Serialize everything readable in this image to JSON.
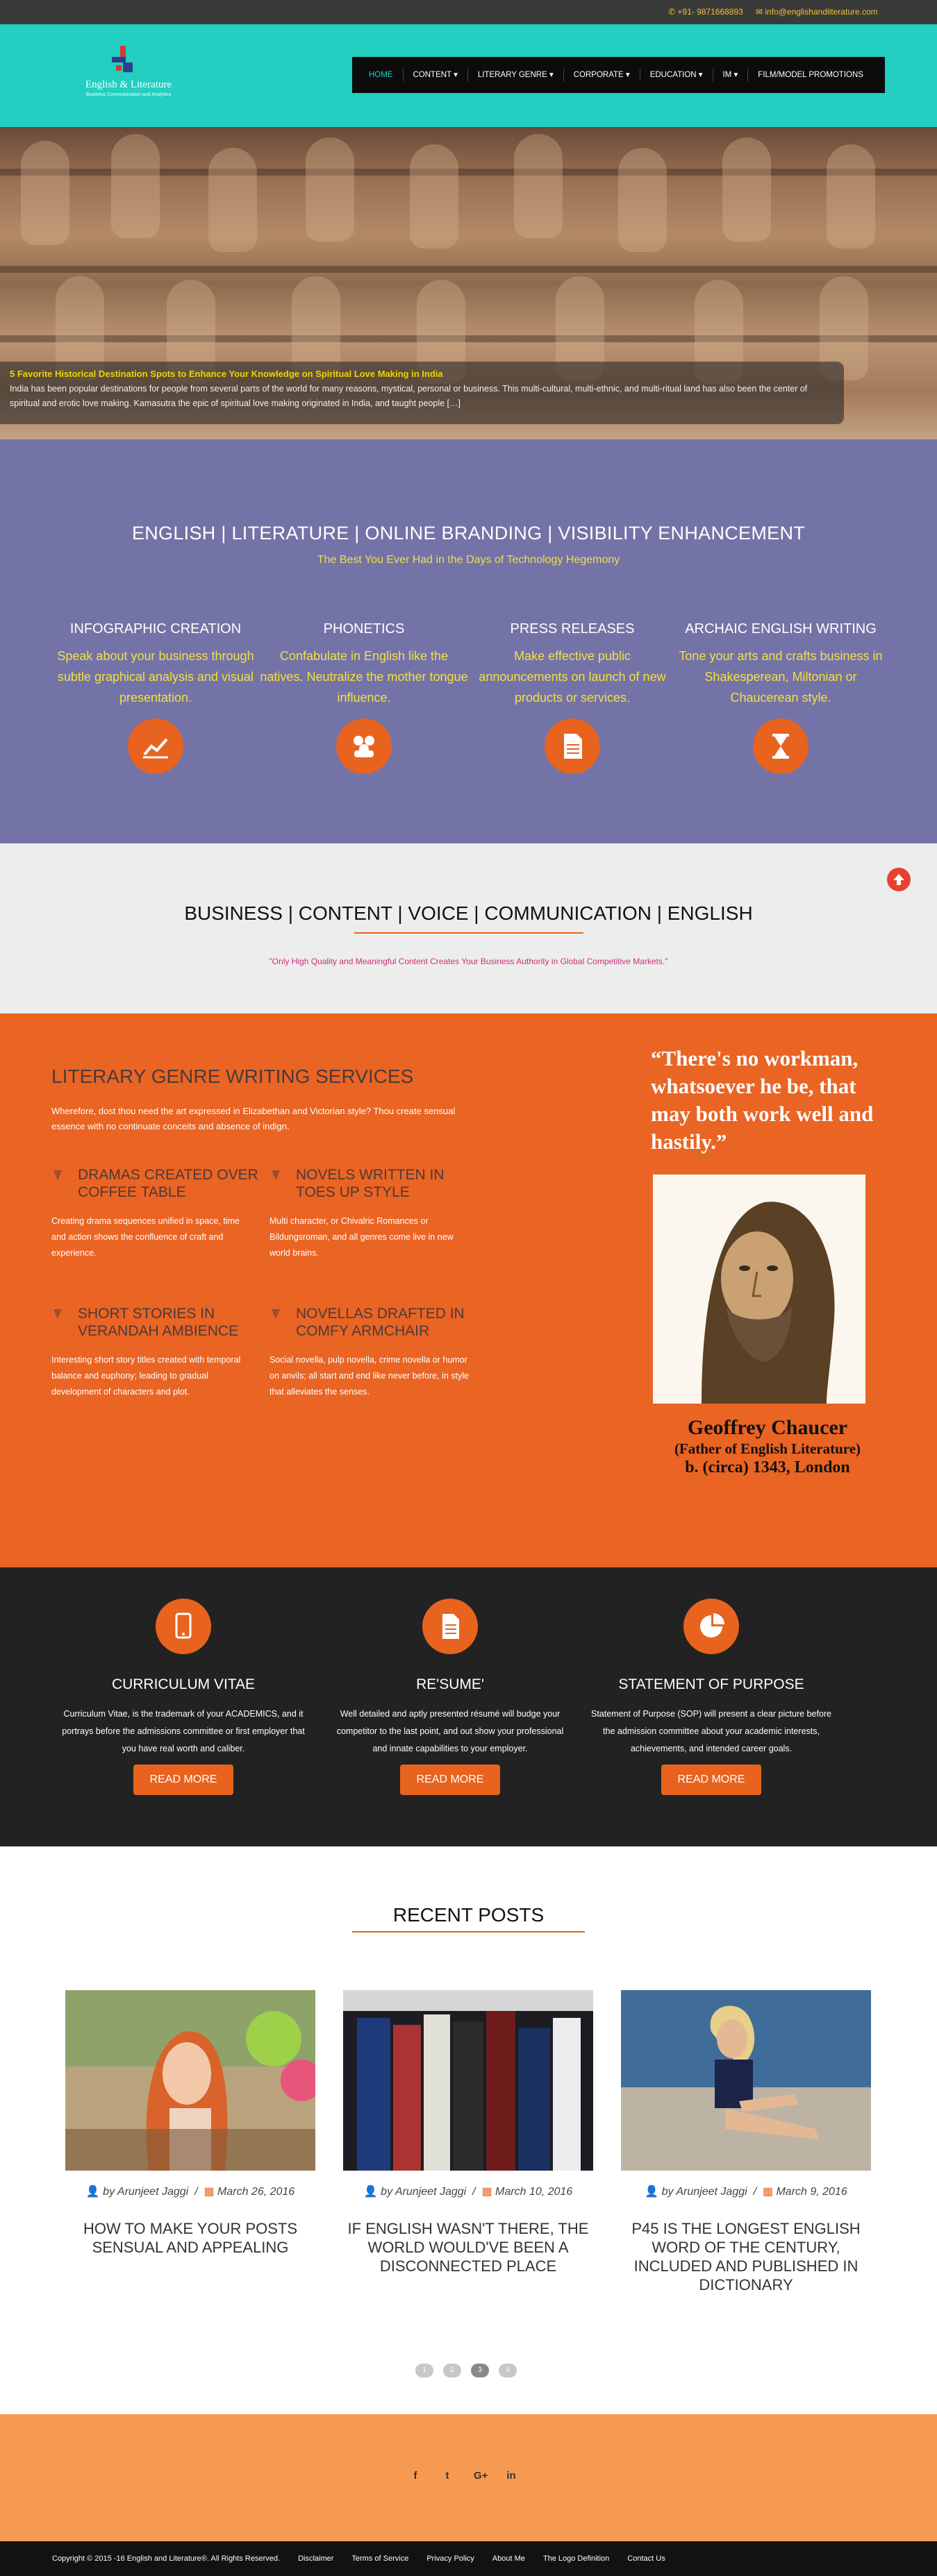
{
  "topbar": {
    "phone": "+91- 9871668893",
    "email": "info@englishandliterature.com"
  },
  "logo": {
    "name": "English & Literature",
    "tagline": "Business Communication and Analytics"
  },
  "nav": {
    "items": [
      "HOME",
      "CONTENT ▾",
      "LITERARY GENRE ▾",
      "CORPORATE ▾",
      "EDUCATION ▾",
      "IM ▾",
      "FILM/MODEL PROMOTIONS"
    ]
  },
  "hero": {
    "title": "5 Favorite Historical Destination Spots to Enhance Your Knowledge on Spiritual Love Making in India",
    "text": "India has been popular destinations for people from several parts of the world for many reasons, mystical, personal or business.  This multi-cultural, multi-ethnic, and multi-ritual land has also been the center of spiritual and erotic love making. Kamasutra the epic of spiritual love making originated in India, and taught people […]"
  },
  "services": {
    "heading": "ENGLISH | LITERATURE | ONLINE BRANDING | VISIBILITY ENHANCEMENT",
    "subheading": "The Best You Ever Had in the Days of Technology Hegemony",
    "items": [
      {
        "title": "INFOGRAPHIC CREATION",
        "desc": "Speak about your business through subtle graphical analysis and visual presentation.",
        "icon": "chart-line-icon"
      },
      {
        "title": "PHONETICS",
        "desc": "Confabulate in English like the natives. Neutralize the mother tongue influence.",
        "icon": "users-icon"
      },
      {
        "title": "PRESS RELEASES",
        "desc": "Make effective public announcements on launch of new products or services.",
        "icon": "document-icon"
      },
      {
        "title": "ARCHAIC ENGLISH WRITING",
        "desc": "Tone your arts and crafts business in Shakesperean, Miltonian or Chaucerean style.",
        "icon": "hourglass-icon"
      }
    ]
  },
  "business": {
    "heading": "BUSINESS | CONTENT | VOICE | COMMUNICATION | ENGLISH",
    "quote": "\"Only High Quality and Meaningful Content Creates Your Business Authority in Global Competitive Markets.\""
  },
  "literary": {
    "heading": "LITERARY GENRE WRITING SERVICES",
    "intro": "Wherefore, dost thou need the art expressed in Elizabethan and Victorian style? Thou create sensual essence with no continuate conceits and absence of indign.",
    "boxes": [
      {
        "title": "DRAMAS CREATED OVER COFFEE TABLE",
        "desc": "Creating drama sequences unified in space, time and action shows the confluence of craft and experience."
      },
      {
        "title": "NOVELS WRITTEN IN TOES UP STYLE",
        "desc": "Multi character, or Chivalric Romances or Bildungsroman, and all genres come live in new world brains."
      },
      {
        "title": "SHORT STORIES IN VERANDAH AMBIENCE",
        "desc": "Interesting short story titles created with temporal balance and euphony; leading to gradual development of characters and plot."
      },
      {
        "title": "NOVELLAS DRAFTED IN COMFY ARMCHAIR",
        "desc": "Social novella, pulp novella, crime novella or humor on anvils; all start and end like never before, in style that alleviates the senses."
      }
    ],
    "quote": "“There's no workman, whatsoever he be, that may both work well and hastily.”",
    "person_name": "Geoffrey Chaucer",
    "person_role": "(Father of English Literature)",
    "person_born": "b. (circa) 1343, London"
  },
  "docs": {
    "items": [
      {
        "title": "CURRICULUM VITAE",
        "desc": "Curriculum Vitae, is the trademark of your ACADEMICS, and it portrays before the admissions committee or first employer that you have real worth and caliber.",
        "button": "READ MORE",
        "icon": "tablet-icon"
      },
      {
        "title": "RE'SUME'",
        "desc": "Well detailed and aptly presented résumé will budge your competitor to the last point, and out show your professional and innate capabilities to your employer.",
        "button": "READ MORE",
        "icon": "file-text-icon"
      },
      {
        "title": "STATEMENT OF PURPOSE",
        "desc": "Statement of Purpose (SOP) will present a clear picture before the admission committee about your academic interests, achievements, and intended career goals.",
        "button": "READ MORE",
        "icon": "pie-chart-icon"
      }
    ]
  },
  "recent": {
    "heading": "RECENT POSTS",
    "posts": [
      {
        "author": "by Arunjeet Jaggi",
        "date": "March 26, 2016",
        "title": "HOW TO MAKE YOUR POSTS SENSUAL AND APPEALING"
      },
      {
        "author": "by Arunjeet Jaggi",
        "date": "March 10, 2016",
        "title": "IF ENGLISH WASN'T THERE, THE WORLD WOULD'VE BEEN A DISCONNECTED PLACE"
      },
      {
        "author": "by Arunjeet Jaggi",
        "date": "March 9, 2016",
        "title": "P45 IS THE LONGEST ENGLISH WORD OF THE CENTURY, INCLUDED AND PUBLISHED IN DICTIONARY"
      }
    ],
    "pages": [
      "1",
      "2",
      "3",
      "4"
    ],
    "current_page": "3"
  },
  "social": [
    "f",
    "t",
    "G+",
    "in"
  ],
  "footer": {
    "copyright": "Copyright © 2015 -16 English and Literature®. All Rights Reserved.",
    "links": [
      "Disclaimer",
      "Terms of Service",
      "Privacy Policy",
      "About Me",
      "The Logo Definition",
      "Contact Us"
    ]
  },
  "colors": {
    "teal": "#22cfc0",
    "purple": "#7473a7",
    "orange": "#ea6423",
    "yellow": "#f1e040",
    "dark": "#222222"
  }
}
